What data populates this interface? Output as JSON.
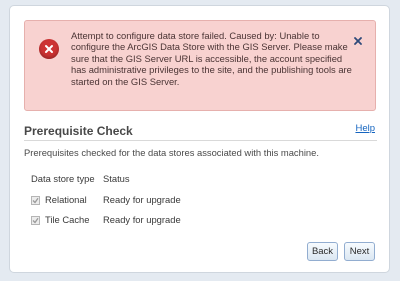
{
  "alert": {
    "message": "Attempt to configure data store failed. Caused by: Unable to configure the ArcGIS Data Store with the GIS Server. Please make sure that the GIS Server URL is accessible, the account specified has administrative privileges to the site, and the publishing tools are started on the GIS Server.",
    "close_label": "×"
  },
  "page": {
    "title": "Prerequisite Check",
    "help_label": "Help",
    "description": "Prerequisites checked for the data stores associated with this machine."
  },
  "table": {
    "headers": [
      "Data store type",
      "Status"
    ],
    "rows": [
      {
        "type": "Relational",
        "status": "Ready for upgrade",
        "checked": true
      },
      {
        "type": "Tile Cache",
        "status": "Ready for upgrade",
        "checked": true
      }
    ]
  },
  "buttons": {
    "back_label": "Back",
    "next_label": "Next"
  },
  "colors": {
    "alert_bg": "#f8d2d0",
    "error_icon": "#cd3333",
    "link": "#1565c0"
  }
}
